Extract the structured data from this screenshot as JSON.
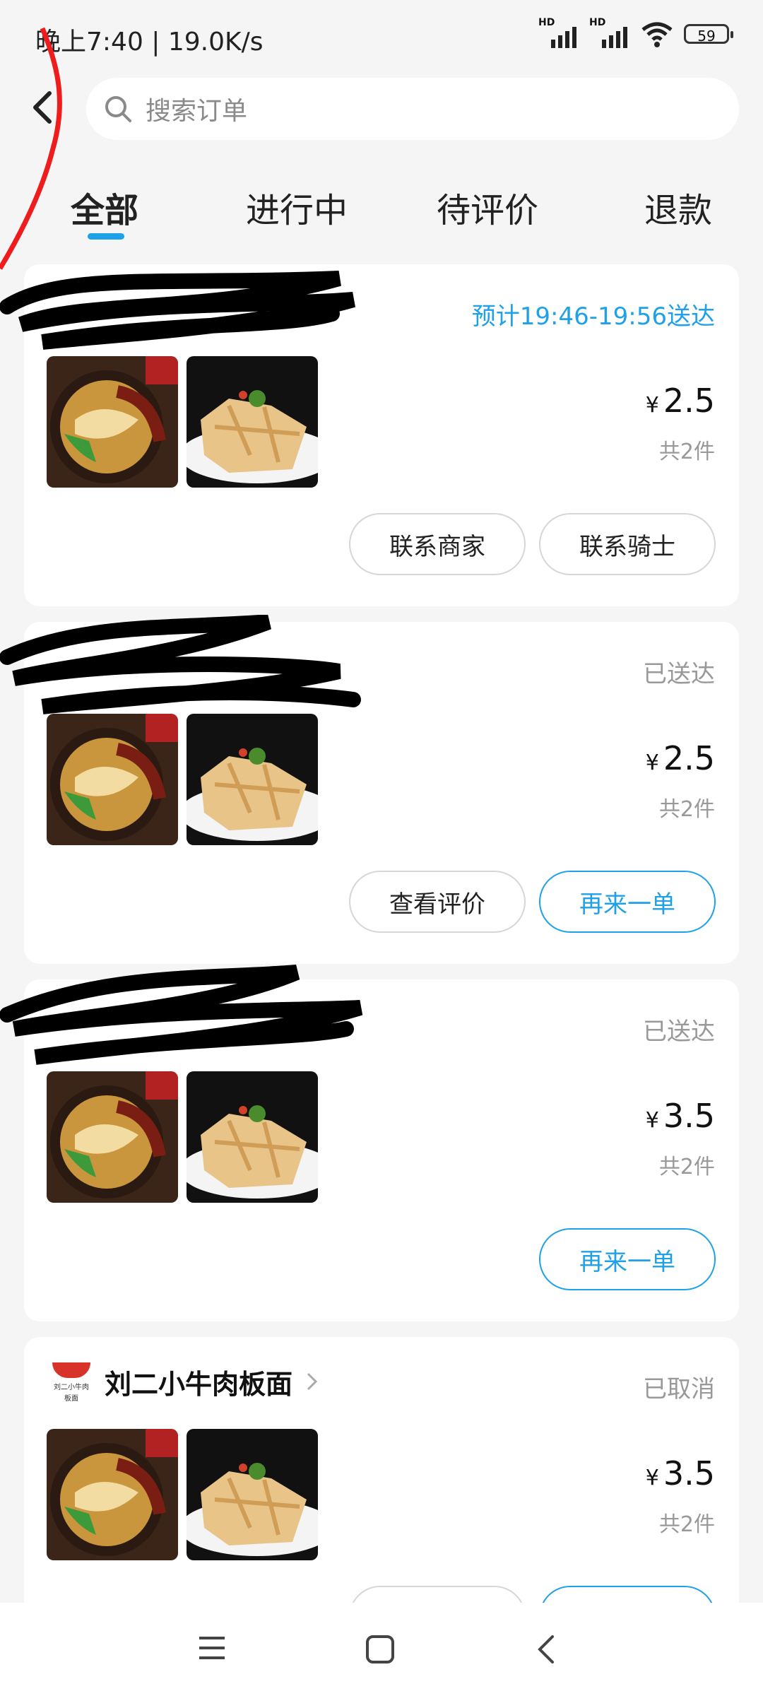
{
  "status_bar": {
    "time_speed": "晚上7:40 | 19.0K/s",
    "battery": "59",
    "hd1": "HD",
    "hd2": "HD"
  },
  "search": {
    "placeholder": "搜索订单"
  },
  "tabs": [
    {
      "label": "全部"
    },
    {
      "label": "进行中"
    },
    {
      "label": "待评价"
    },
    {
      "label": "退款"
    }
  ],
  "orders": [
    {
      "status": "预计19:46-19:56送达",
      "price": "2.5",
      "currency": "¥",
      "count": "共2件",
      "buttons": [
        "联系商家",
        "联系骑士"
      ]
    },
    {
      "status": "已送达",
      "price": "2.5",
      "currency": "¥",
      "count": "共2件",
      "buttons": [
        "查看评价",
        "再来一单"
      ]
    },
    {
      "status": "已送达",
      "price": "3.5",
      "currency": "¥",
      "count": "共2件",
      "buttons": [
        "再来一单"
      ]
    },
    {
      "shop_name": "刘二小牛肉板面",
      "logo_text_1": "刘二小牛肉",
      "logo_text_2": "板面",
      "status": "已取消",
      "price": "3.5",
      "currency": "¥",
      "count": "共2件"
    }
  ],
  "colors": {
    "accent": "#1ea1e8",
    "muted": "#999999",
    "background": "#f5f5f5"
  },
  "icons": [
    "back-arrow-icon",
    "search-icon",
    "menu-icon",
    "home-icon",
    "back-nav-icon",
    "wifi-icon",
    "signal-icon"
  ]
}
